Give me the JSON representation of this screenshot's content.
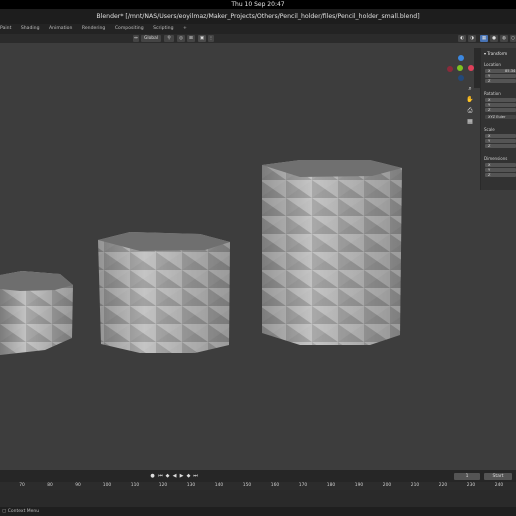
{
  "system_bar": {
    "clock": "Thu 10 Sep  20:47"
  },
  "window": {
    "title": "Blender* [/mnt/NAS/Users/eoyilmaz/Maker_Projects/Others/Pencil_holder/files/Pencil_holder_small.blend]"
  },
  "workspaces": [
    "Paint",
    "Shading",
    "Animation",
    "Rendering",
    "Compositing",
    "Scripting",
    "+"
  ],
  "viewport_header": {
    "transform_orientation": "Global"
  },
  "sidebar": {
    "tab_label": "Item",
    "panel_title": "Transform",
    "location_label": "Location",
    "location_x_value": "85.34",
    "rotation_label": "Rotation",
    "rotation_mode": "XYZ Euler",
    "scale_label": "Scale",
    "dimensions_label": "Dimensions",
    "x_label": "X",
    "y_label": "Y",
    "z_label": "Z"
  },
  "timeline": {
    "current_frame": "1",
    "start_label": "Start",
    "ruler_ticks": [
      "70",
      "80",
      "90",
      "100",
      "110",
      "120",
      "130",
      "140",
      "150",
      "160",
      "170",
      "180",
      "190",
      "200",
      "210",
      "220",
      "230",
      "240"
    ]
  },
  "status_bar": {
    "text": "Context Menu"
  },
  "colors": {
    "accent": "#4772b3",
    "axis_x": "#e0405a",
    "axis_y": "#7fc320",
    "axis_z": "#3c88e0"
  }
}
